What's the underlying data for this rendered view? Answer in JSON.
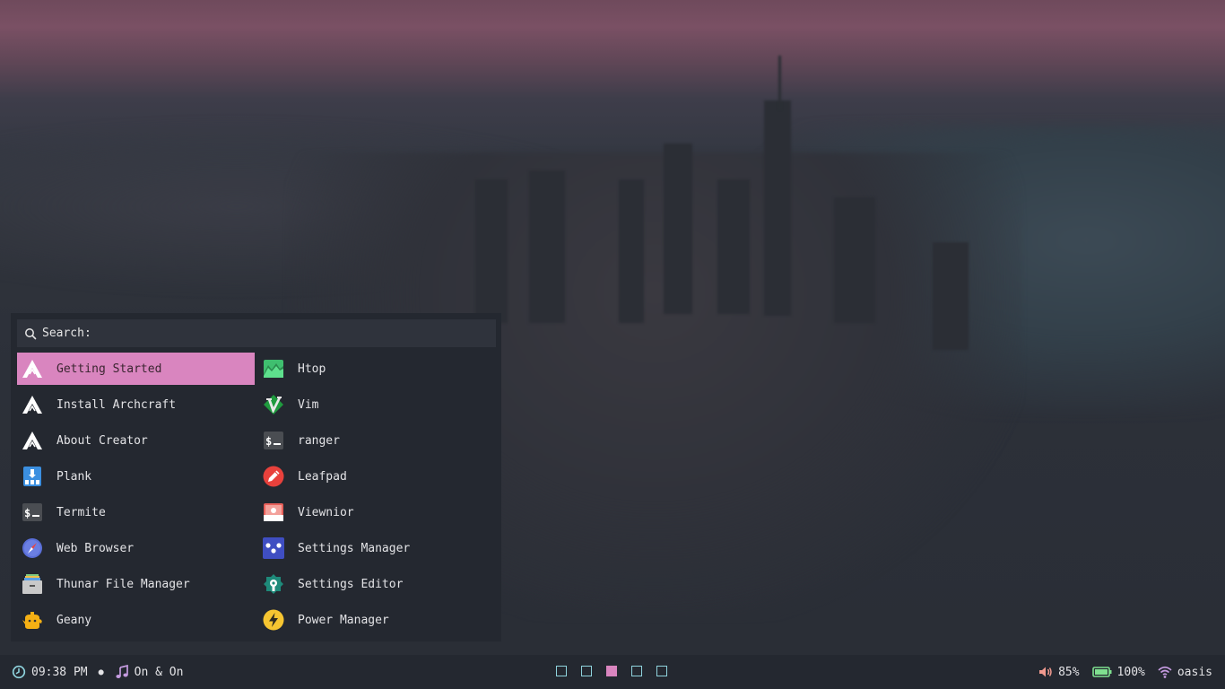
{
  "launcher": {
    "search_label": "Search:",
    "left_apps": [
      {
        "label": "Getting Started",
        "icon": "archcraft-logo-icon",
        "selected": true
      },
      {
        "label": "Install Archcraft",
        "icon": "archcraft-logo-icon"
      },
      {
        "label": "About Creator",
        "icon": "archcraft-logo-icon"
      },
      {
        "label": "Plank",
        "icon": "plank-dock-icon"
      },
      {
        "label": "Termite",
        "icon": "terminal-icon"
      },
      {
        "label": "Web Browser",
        "icon": "compass-icon"
      },
      {
        "label": "Thunar File Manager",
        "icon": "file-cabinet-icon"
      },
      {
        "label": "Geany",
        "icon": "teapot-icon"
      }
    ],
    "right_apps": [
      {
        "label": "Htop",
        "icon": "system-monitor-icon"
      },
      {
        "label": "Vim",
        "icon": "vim-icon"
      },
      {
        "label": "ranger",
        "icon": "terminal-icon"
      },
      {
        "label": "Leafpad",
        "icon": "pencil-icon"
      },
      {
        "label": "Viewnior",
        "icon": "image-viewer-icon"
      },
      {
        "label": "Settings Manager",
        "icon": "settings-dots-icon"
      },
      {
        "label": "Settings Editor",
        "icon": "settings-editor-icon"
      },
      {
        "label": "Power Manager",
        "icon": "lightning-icon"
      }
    ]
  },
  "bar": {
    "time": "09:38 PM",
    "music": "On & On",
    "workspaces": [
      false,
      false,
      true,
      false,
      false
    ],
    "volume": "85%",
    "battery": "100%",
    "network": "oasis"
  },
  "colors": {
    "accent": "#d985bf",
    "workspace_outline": "#8fd3dd",
    "panel_bg": "#242830"
  }
}
